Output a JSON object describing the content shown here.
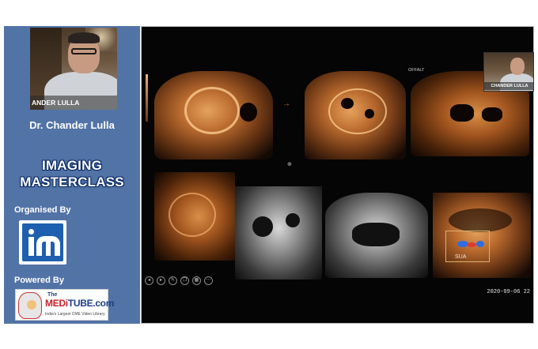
{
  "sidebar": {
    "speaker_video_tag": "ANDER LULLA",
    "speaker_name": "Dr. Chander Lulla",
    "masterclass_line1": "IMAGING",
    "masterclass_line2": "MASTERCLASS",
    "organised_by": "Organised By",
    "powered_by": "Powered By",
    "meditube": {
      "the": "The",
      "brand_pre": "MEDi",
      "brand_post": "TUBE.com",
      "tagline": "India's Largest CME Video Library"
    }
  },
  "viewer": {
    "thumbnail_tag": "CHANDER LULLA",
    "offset_label": "OFFALT",
    "sua_label": "SUA",
    "timestamp": "2020-09-06 22",
    "toolbar": [
      {
        "icon": "prev-icon",
        "glyph": "◂"
      },
      {
        "icon": "next-icon",
        "glyph": "▸"
      },
      {
        "icon": "pen-icon",
        "glyph": "✎"
      },
      {
        "icon": "copy-icon",
        "glyph": "❐"
      },
      {
        "icon": "grid-icon",
        "glyph": "▦"
      },
      {
        "icon": "more-icon",
        "glyph": "⋯"
      }
    ]
  },
  "colors": {
    "sidebar_bg": "#5273a6",
    "title_outline": "#0a2a66",
    "im_blue": "#1e5fb0",
    "meditube_red": "#c8202a",
    "meditube_blue": "#1a3f85"
  }
}
